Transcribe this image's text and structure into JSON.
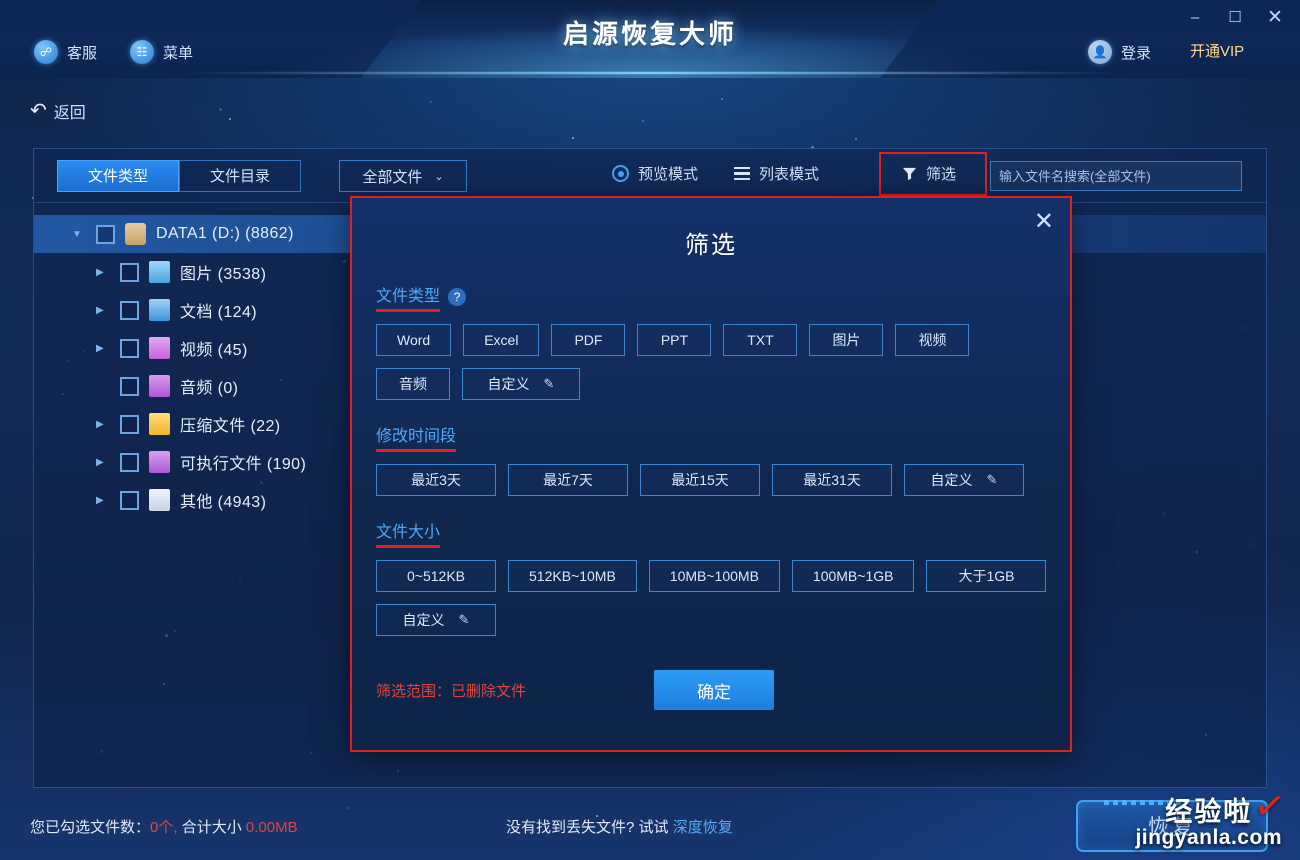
{
  "window": {
    "title": "启源恢复大师",
    "minimize": "–",
    "maximize": "☐",
    "close": "✕"
  },
  "titlebar": {
    "support_label": "客服",
    "menu_label": "菜单",
    "login_label": "登录",
    "vip_label": "开通VIP"
  },
  "nav": {
    "back_label": "返回",
    "back_icon": "↶"
  },
  "toolbar": {
    "tabs": [
      {
        "label": "文件类型",
        "active": true
      },
      {
        "label": "文件目录",
        "active": false
      }
    ],
    "dropdown_value": "全部文件",
    "dropdown_caret": "⌄",
    "preview_mode": "预览模式",
    "list_mode": "列表模式",
    "filter_label": "筛选",
    "search_placeholder": "输入文件名搜索(全部文件)",
    "search_value": ""
  },
  "tree": {
    "root": {
      "label": "DATA1 (D:) (8862)",
      "selected": true,
      "icon_color": "#d8b27a"
    },
    "items": [
      {
        "label": "图片 (3538)",
        "icon_color": "#4fa8e8",
        "expandable": true
      },
      {
        "label": "文档 (124)",
        "icon_color": "#3f93dd",
        "expandable": true
      },
      {
        "label": "视频 (45)",
        "icon_color": "#cc6fe0",
        "expandable": true
      },
      {
        "label": "音频 (0)",
        "icon_color": "#b45fd8",
        "expandable": false
      },
      {
        "label": "压缩文件 (22)",
        "icon_color": "#f0c040",
        "expandable": true
      },
      {
        "label": "可执行文件 (190)",
        "icon_color": "#b766e0",
        "expandable": true
      },
      {
        "label": "其他 (4943)",
        "icon_color": "#dfe7f2",
        "expandable": true
      }
    ]
  },
  "dialog": {
    "title": "筛选",
    "close_icon": "✕",
    "file_type": {
      "heading": "文件类型",
      "help_icon": "?",
      "chips": [
        "Word",
        "Excel",
        "PDF",
        "PPT",
        "TXT",
        "图片",
        "视频",
        "音频"
      ],
      "custom_label": "自定义",
      "custom_icon": "✎"
    },
    "modified_time": {
      "heading": "修改时间段",
      "chips": [
        "最近3天",
        "最近7天",
        "最近15天",
        "最近31天"
      ],
      "custom_label": "自定义",
      "custom_icon": "✎"
    },
    "file_size": {
      "heading": "文件大小",
      "chips": [
        "0~512KB",
        "512KB~10MB",
        "10MB~100MB",
        "100MB~1GB",
        "大于1GB"
      ],
      "custom_label": "自定义",
      "custom_icon": "✎"
    },
    "scope_text": "筛选范围：已删除文件",
    "confirm_label": "确定"
  },
  "footer": {
    "selected_prefix": "您已勾选文件数：",
    "selected_count": "0个,",
    "size_prefix": "合计大小",
    "selected_size": "0.00MB",
    "hint_text": "没有找到丢失文件? 试试",
    "hint_link": "深度恢复",
    "recover_label": "恢复"
  },
  "watermark": {
    "cn": "经验啦",
    "en": "jingyanla.com",
    "tick": "✓"
  },
  "colors": {
    "accent": "#2a8cf0",
    "annotation_red": "#e02020",
    "section_heading": "#4fa9f8",
    "link": "#55acf5"
  }
}
